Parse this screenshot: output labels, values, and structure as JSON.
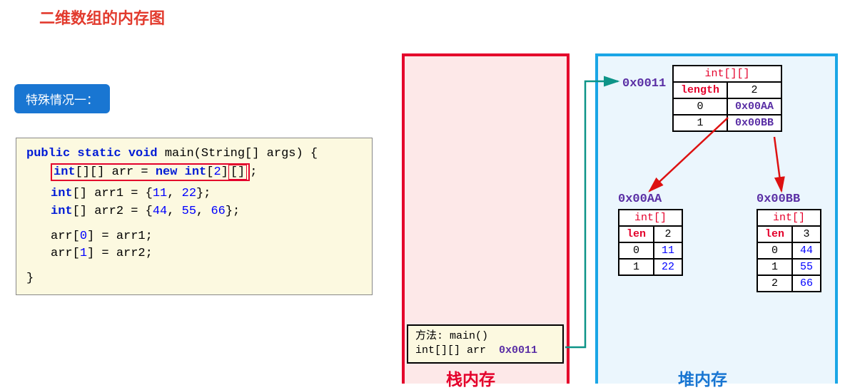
{
  "title": "二维数组的内存图",
  "badge": "特殊情况一：",
  "code": {
    "l1a": "public static void",
    "l1b": " main(String[] args) {",
    "l2a": "int",
    "l2b": "[][] arr = ",
    "l2c": "new int",
    "l2d": "[",
    "l2e": "2",
    "l2f": "]",
    "l2g": "[]",
    "l2h": ";",
    "l3a": "int",
    "l3b": "[] arr1 = {",
    "l3c": "11",
    "l3d": ", ",
    "l3e": "22",
    "l3f": "};",
    "l4a": "int",
    "l4b": "[] arr2 = {",
    "l4c": "44",
    "l4d": ", ",
    "l4e": "55",
    "l4f": ", ",
    "l4g": "66",
    "l4h": "};",
    "l5": "arr[",
    "l5b": "0",
    "l5c": "] = arr1;",
    "l6": "arr[",
    "l6b": "1",
    "l6c": "] = arr2;",
    "l7": "}"
  },
  "stack": {
    "label": "栈内存",
    "frame": {
      "method": "方法: main()",
      "var": "int[][] arr",
      "addr": "0x0011"
    }
  },
  "heap": {
    "label": "堆内存",
    "outer": {
      "addr": "0x0011",
      "type": "int[][]",
      "lenLabel": "length",
      "len": "2",
      "rows": [
        {
          "idx": "0",
          "val": "0x00AA"
        },
        {
          "idx": "1",
          "val": "0x00BB"
        }
      ]
    },
    "arrA": {
      "addr": "0x00AA",
      "type": "int[]",
      "lenLabel": "len",
      "len": "2",
      "rows": [
        {
          "idx": "0",
          "val": "11"
        },
        {
          "idx": "1",
          "val": "22"
        }
      ]
    },
    "arrB": {
      "addr": "0x00BB",
      "type": "int[]",
      "lenLabel": "len",
      "len": "3",
      "rows": [
        {
          "idx": "0",
          "val": "44"
        },
        {
          "idx": "1",
          "val": "55"
        },
        {
          "idx": "2",
          "val": "66"
        }
      ]
    }
  },
  "chart_data": {
    "type": "table",
    "title": "二维数组的内存图",
    "stack": {
      "frame": "main()",
      "variables": [
        {
          "name": "arr",
          "type": "int[][]",
          "address": "0x0011"
        }
      ]
    },
    "heap_objects": [
      {
        "address": "0x0011",
        "type": "int[][]",
        "length": 2,
        "slots": [
          "0x00AA",
          "0x00BB"
        ]
      },
      {
        "address": "0x00AA",
        "type": "int[]",
        "length": 2,
        "slots": [
          11,
          22
        ]
      },
      {
        "address": "0x00BB",
        "type": "int[]",
        "length": 3,
        "slots": [
          44,
          55,
          66
        ]
      }
    ],
    "code": [
      "public static void main(String[] args) {",
      "    int[][] arr = new int[2][];",
      "    int[] arr1 = {11, 22};",
      "    int[] arr2 = {44, 55, 66};",
      "    arr[0] = arr1;",
      "    arr[1] = arr2;",
      "}"
    ]
  }
}
